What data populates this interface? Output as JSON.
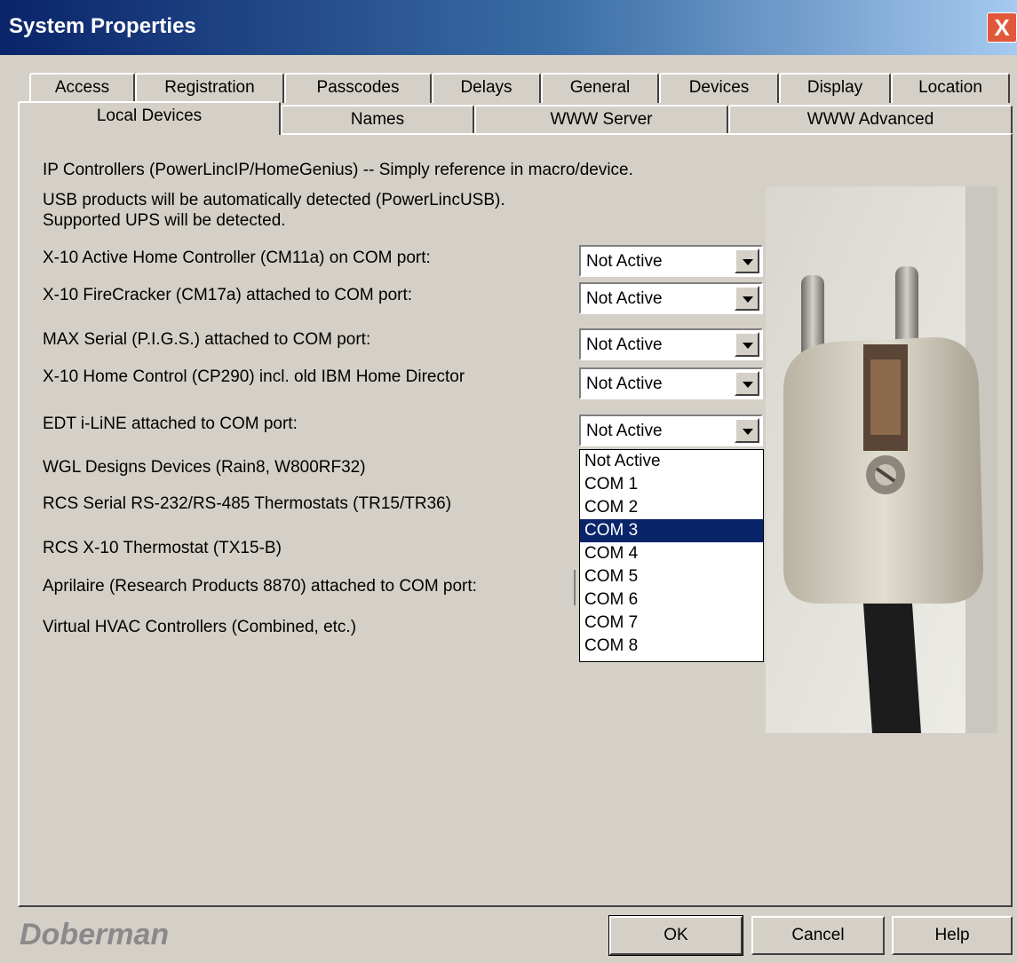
{
  "window": {
    "title": "System Properties",
    "close_glyph": "X"
  },
  "tabs_row1": [
    "Access",
    "Registration",
    "Passcodes",
    "Delays",
    "General",
    "Devices",
    "Display",
    "Location"
  ],
  "tabs_row2": [
    "Local Devices",
    "Names",
    "WWW Server",
    "WWW Advanced"
  ],
  "active_tab": "Local Devices",
  "intro": {
    "line1": "IP Controllers (PowerLincIP/HomeGenius) -- Simply reference in macro/device.",
    "line2": "USB products will be automatically detected (PowerLincUSB).",
    "line3": "Supported UPS will be detected."
  },
  "devices": [
    {
      "label": "X-10 Active Home Controller (CM11a) on COM port:",
      "value": "Not Active"
    },
    {
      "label": "X-10 FireCracker (CM17a) attached to COM port:",
      "value": "Not Active"
    },
    {
      "label": "MAX Serial (P.I.G.S.) attached to COM port:",
      "value": "Not Active"
    },
    {
      "label": "X-10 Home Control (CP290) incl. old IBM Home Director",
      "value": "Not Active"
    },
    {
      "label": "EDT i-LiNE attached to COM port:",
      "value": "Not Active"
    },
    {
      "label": "WGL Designs Devices (Rain8, W800RF32)"
    },
    {
      "label": "RCS Serial RS-232/RS-485 Thermostats (TR15/TR36)"
    },
    {
      "label": "RCS X-10 Thermostat (TX15-B)"
    },
    {
      "label": "Aprilaire (Research Products 8870)  attached to COM port:"
    },
    {
      "label": "Virtual HVAC Controllers (Combined, etc.)"
    }
  ],
  "dropdown": {
    "options": [
      "Not Active",
      "COM 1",
      "COM 2",
      "COM 3",
      "COM 4",
      "COM 5",
      "COM 6",
      "COM 7",
      "COM 8"
    ],
    "highlighted": "COM 3"
  },
  "footer": {
    "brand": "Doberman",
    "ok": "OK",
    "cancel": "Cancel",
    "help": "Help"
  },
  "colors": {
    "titlebar": "#0a246a",
    "selection": "#0a246a",
    "face": "#d4d0c8"
  },
  "icons": {
    "close": "close-icon",
    "dropdown_arrow": "chevron-down-icon",
    "photo": "power-plug-photo"
  }
}
